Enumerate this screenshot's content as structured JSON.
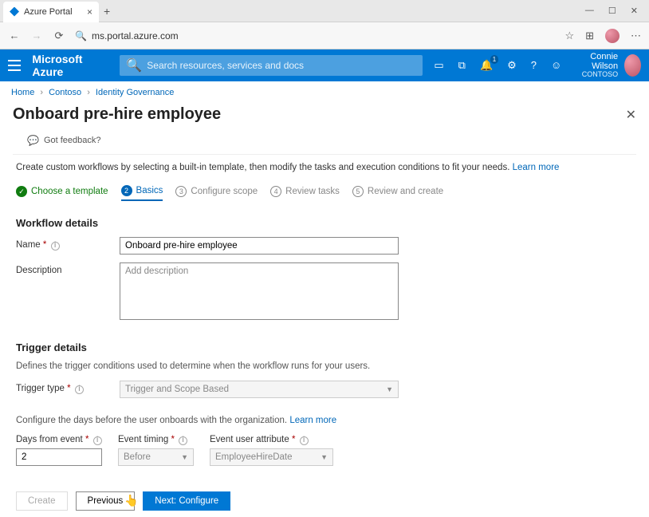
{
  "browser": {
    "tab_title": "Azure Portal",
    "url": "ms.portal.azure.com"
  },
  "portal": {
    "brand": "Microsoft Azure",
    "search_placeholder": "Search resources, services and docs",
    "notification_badge": "1",
    "user_name": "Connie Wilson",
    "user_org": "Contoso"
  },
  "breadcrumb": {
    "items": [
      "Home",
      "Contoso",
      "Identity Governance"
    ]
  },
  "page": {
    "title": "Onboard pre-hire employee",
    "feedback": "Got feedback?",
    "intro_text": "Create custom workflows by selecting a built-in template, then modify the tasks and execution conditions to fit your needs.",
    "intro_link": "Learn more"
  },
  "wizard": {
    "steps": [
      {
        "label": "Choose a template"
      },
      {
        "num": "2",
        "label": "Basics"
      },
      {
        "num": "3",
        "label": "Configure scope"
      },
      {
        "num": "4",
        "label": "Review tasks"
      },
      {
        "num": "5",
        "label": "Review and create"
      }
    ]
  },
  "form": {
    "workflow_section": "Workflow details",
    "name_label": "Name",
    "name_value": "Onboard pre-hire employee",
    "desc_label": "Description",
    "desc_placeholder": "Add description",
    "trigger_section": "Trigger details",
    "trigger_helper": "Defines the trigger conditions used to determine when the workflow runs for your users.",
    "trigger_type_label": "Trigger type",
    "trigger_type_value": "Trigger and Scope Based",
    "days_helper_text": "Configure the days before the user onboards with the organization.",
    "days_helper_link": "Learn more",
    "days_label": "Days from event",
    "days_value": "2",
    "timing_label": "Event timing",
    "timing_value": "Before",
    "attr_label": "Event user attribute",
    "attr_value": "EmployeeHireDate"
  },
  "footer": {
    "create": "Create",
    "previous": "Previous",
    "next": "Next: Configure"
  }
}
